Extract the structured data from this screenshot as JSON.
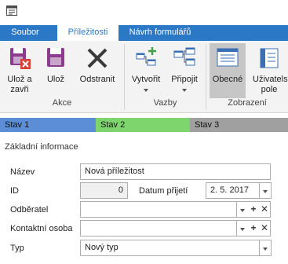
{
  "ribbon": {
    "tabs": [
      "Soubor",
      "Příležitosti",
      "Návrh formulářů"
    ],
    "buttons": {
      "save_close": [
        "Ulož a",
        "zavři"
      ],
      "save": "Ulož",
      "delete": "Odstranit",
      "create": "Vytvořit",
      "link": "Připojit",
      "general": "Obecné",
      "user_fields": [
        "Uživatelsk",
        "pole"
      ]
    },
    "groups": [
      "Akce",
      "Vazby",
      "Zobrazení"
    ]
  },
  "stages": [
    {
      "label": "Stav 1",
      "color": "#5b8ed6"
    },
    {
      "label": "Stav 2",
      "color": "#7ed56e"
    },
    {
      "label": "Stav 3",
      "color": "#a0a0a0"
    }
  ],
  "form": {
    "section": "Základní informace",
    "name_label": "Název",
    "name_value": "Nová příležitost",
    "id_label": "ID",
    "id_value": "0",
    "date_label": "Datum přijetí",
    "date_value": "2. 5. 2017",
    "customer_label": "Odběratel",
    "customer_value": "",
    "contact_label": "Kontaktní osoba",
    "contact_value": "",
    "type_label": "Typ",
    "type_value": "Nový typ"
  },
  "colors": {
    "accent": "#2b78c6",
    "ribbon_bg": "#f3f3f3"
  }
}
